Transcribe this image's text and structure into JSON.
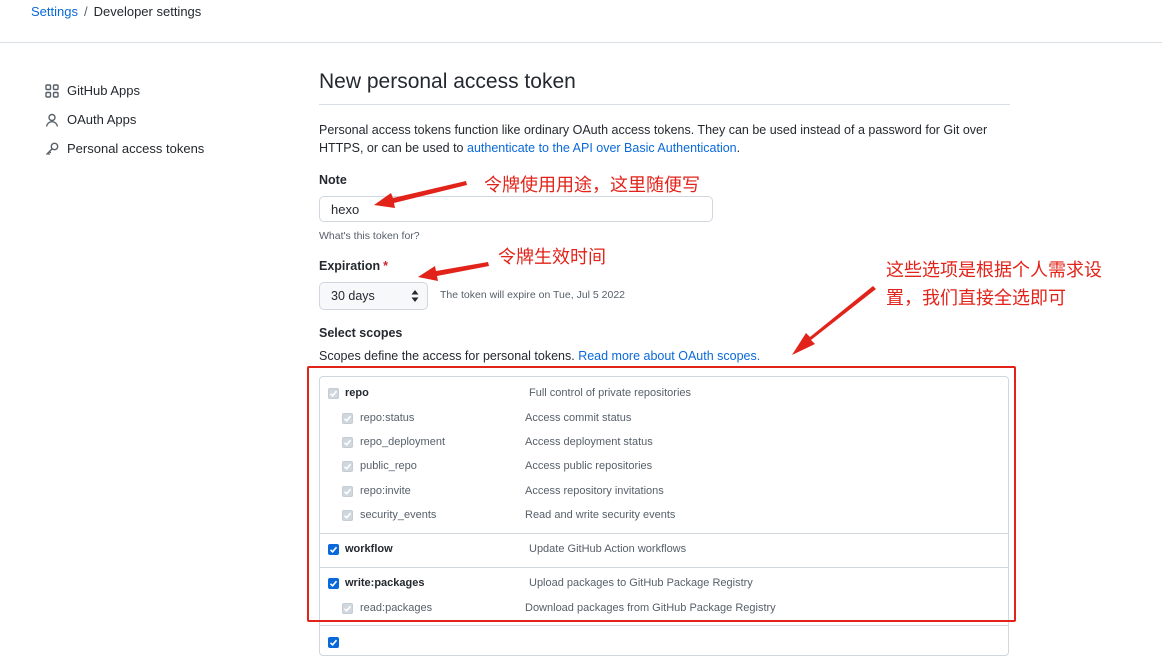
{
  "breadcrumb": {
    "settings": "Settings",
    "separator": "/",
    "current": "Developer settings"
  },
  "sidebar": {
    "items": [
      {
        "label": "GitHub Apps",
        "icon": "apps-grid-icon"
      },
      {
        "label": "OAuth Apps",
        "icon": "person-icon"
      },
      {
        "label": "Personal access tokens",
        "icon": "key-icon"
      }
    ]
  },
  "page": {
    "title": "New personal access token",
    "intro_text": "Personal access tokens function like ordinary OAuth access tokens. They can be used instead of a password for Git over HTTPS, or can be used to ",
    "intro_link": "authenticate to the API over Basic Authentication",
    "intro_end": "."
  },
  "note": {
    "label": "Note",
    "value": "hexo",
    "hint": "What's this token for?"
  },
  "expiration": {
    "label": "Expiration",
    "required_mark": "*",
    "selected": "30 days",
    "hint": "The token will expire on Tue, Jul 5 2022"
  },
  "scopes": {
    "label": "Select scopes",
    "desc": "Scopes define the access for personal tokens. ",
    "desc_link": "Read more about OAuth scopes."
  },
  "scope_rows": [
    {
      "name": "repo",
      "desc": "Full control of private repositories",
      "state": "disabled"
    },
    {
      "name": "repo:status",
      "desc": "Access commit status",
      "state": "disabled"
    },
    {
      "name": "repo_deployment",
      "desc": "Access deployment status",
      "state": "disabled"
    },
    {
      "name": "public_repo",
      "desc": "Access public repositories",
      "state": "disabled"
    },
    {
      "name": "repo:invite",
      "desc": "Access repository invitations",
      "state": "disabled"
    },
    {
      "name": "security_events",
      "desc": "Read and write security events",
      "state": "disabled"
    },
    {
      "name": "workflow",
      "desc": "Update GitHub Action workflows",
      "state": "checked"
    },
    {
      "name": "write:packages",
      "desc": "Upload packages to GitHub Package Registry",
      "state": "checked"
    },
    {
      "name": "read:packages",
      "desc": "Download packages from GitHub Package Registry",
      "state": "disabled"
    }
  ],
  "annotations": {
    "note": "令牌使用用途，这里随便写",
    "expiration": "令牌生效时间",
    "scopes_line1": "这些选项是根据个人需求设",
    "scopes_line2": "置，我们直接全选即可",
    "color": "#e2231a"
  }
}
